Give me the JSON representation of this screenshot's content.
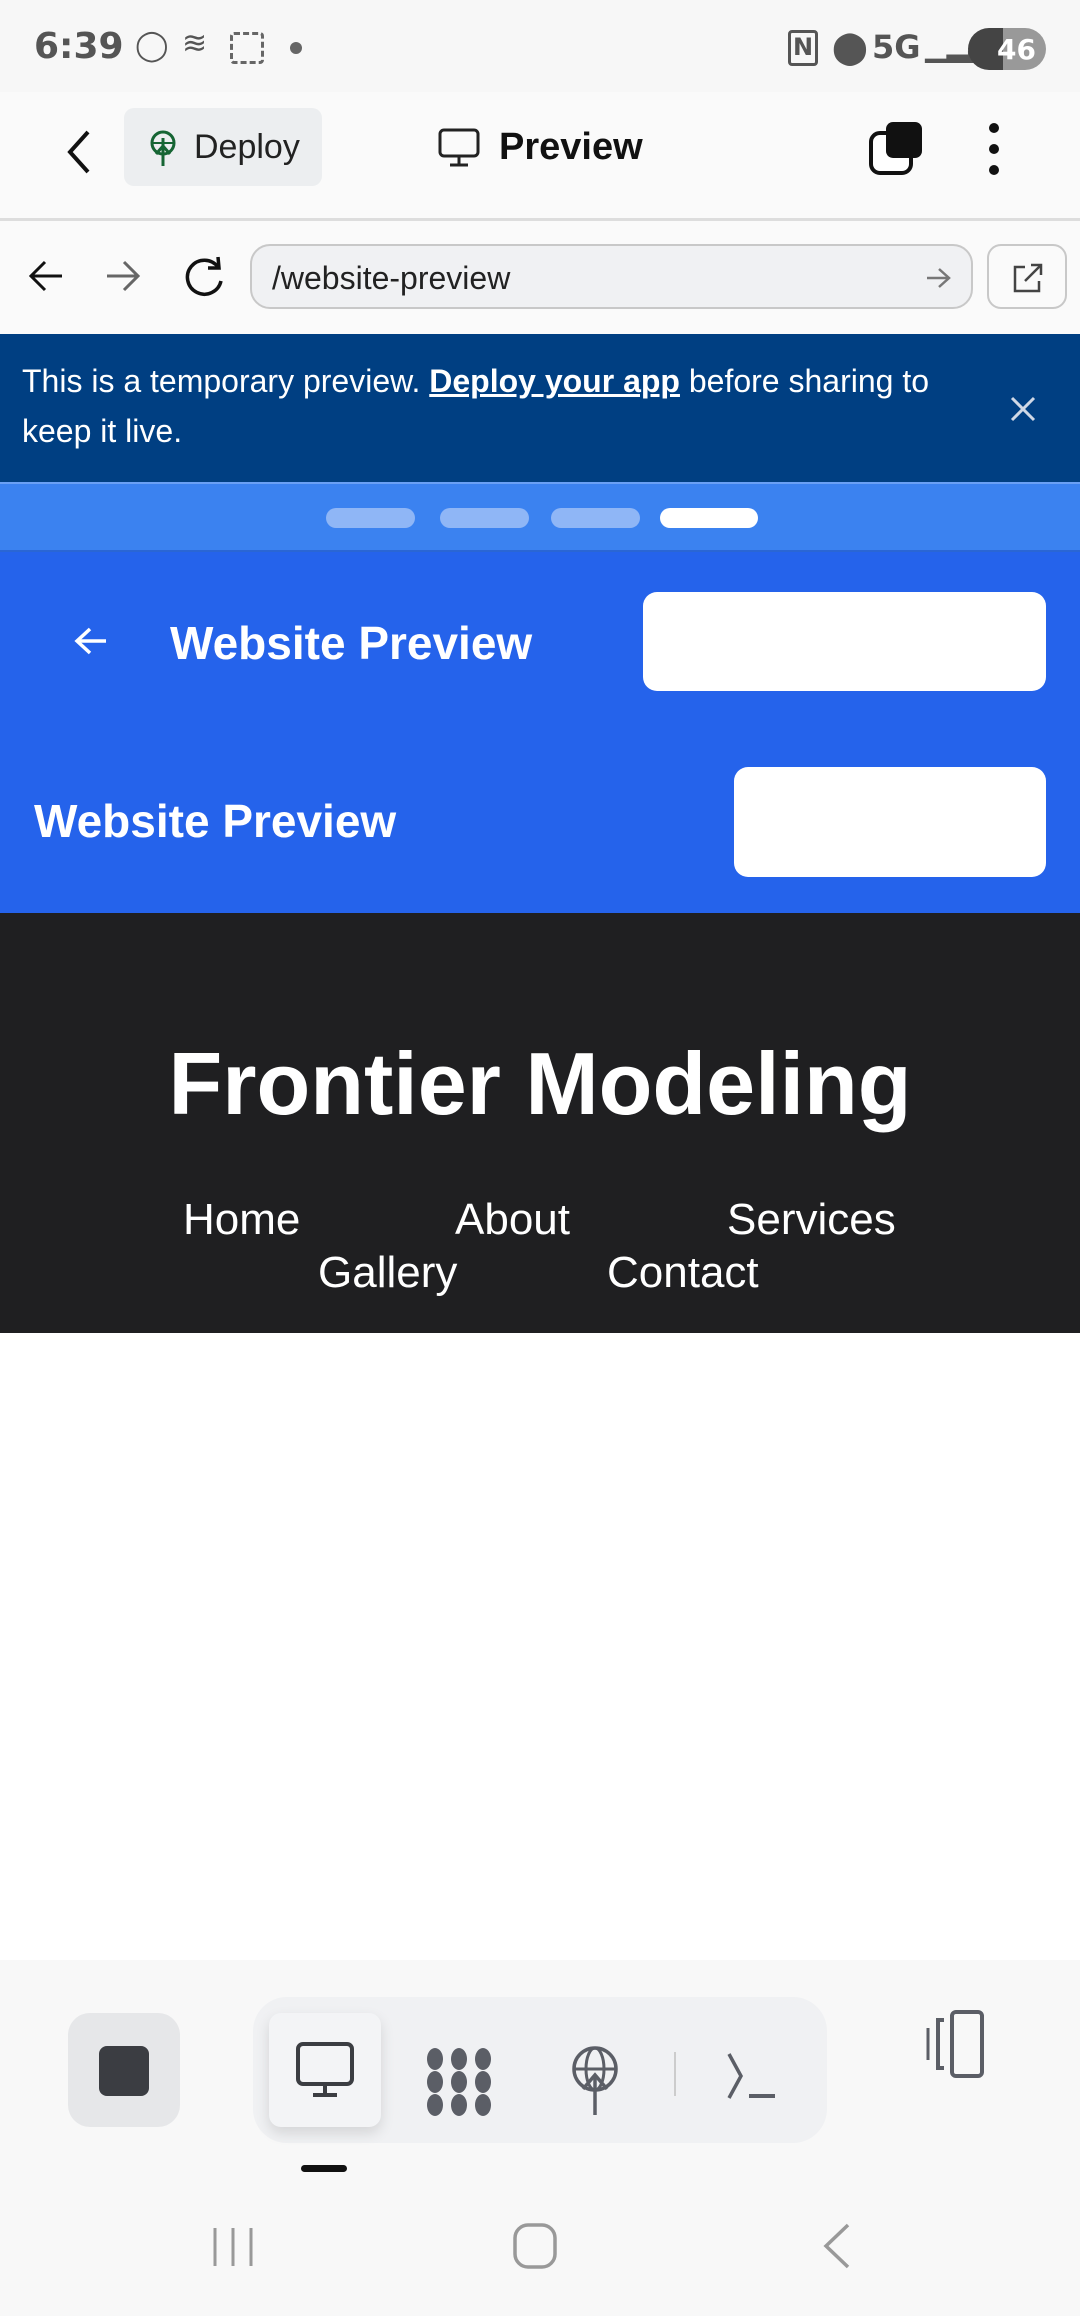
{
  "status_bar": {
    "time": "6:39",
    "network": "5G",
    "battery": "46"
  },
  "header": {
    "deploy_label": "Deploy",
    "title": "Preview"
  },
  "url_bar": {
    "value": "/website-preview"
  },
  "banner": {
    "text_before": "This is a temporary preview. ",
    "link": "Deploy your app",
    "text_after": " before sharing to keep it live."
  },
  "site": {
    "header_title_1": "Website Preview",
    "header_title_2": "Website Preview",
    "hero_title": "Frontier Modeling",
    "nav": [
      "Home",
      "About",
      "Services",
      "Gallery",
      "Contact"
    ]
  },
  "colors": {
    "banner": "#003f82",
    "site_header": "#2563eb",
    "hero": "#1f1f21"
  },
  "toolbar_icons": [
    "stop-icon",
    "monitor-icon",
    "network-icon",
    "deploy-icon",
    "terminal-icon",
    "device-frame-icon"
  ]
}
